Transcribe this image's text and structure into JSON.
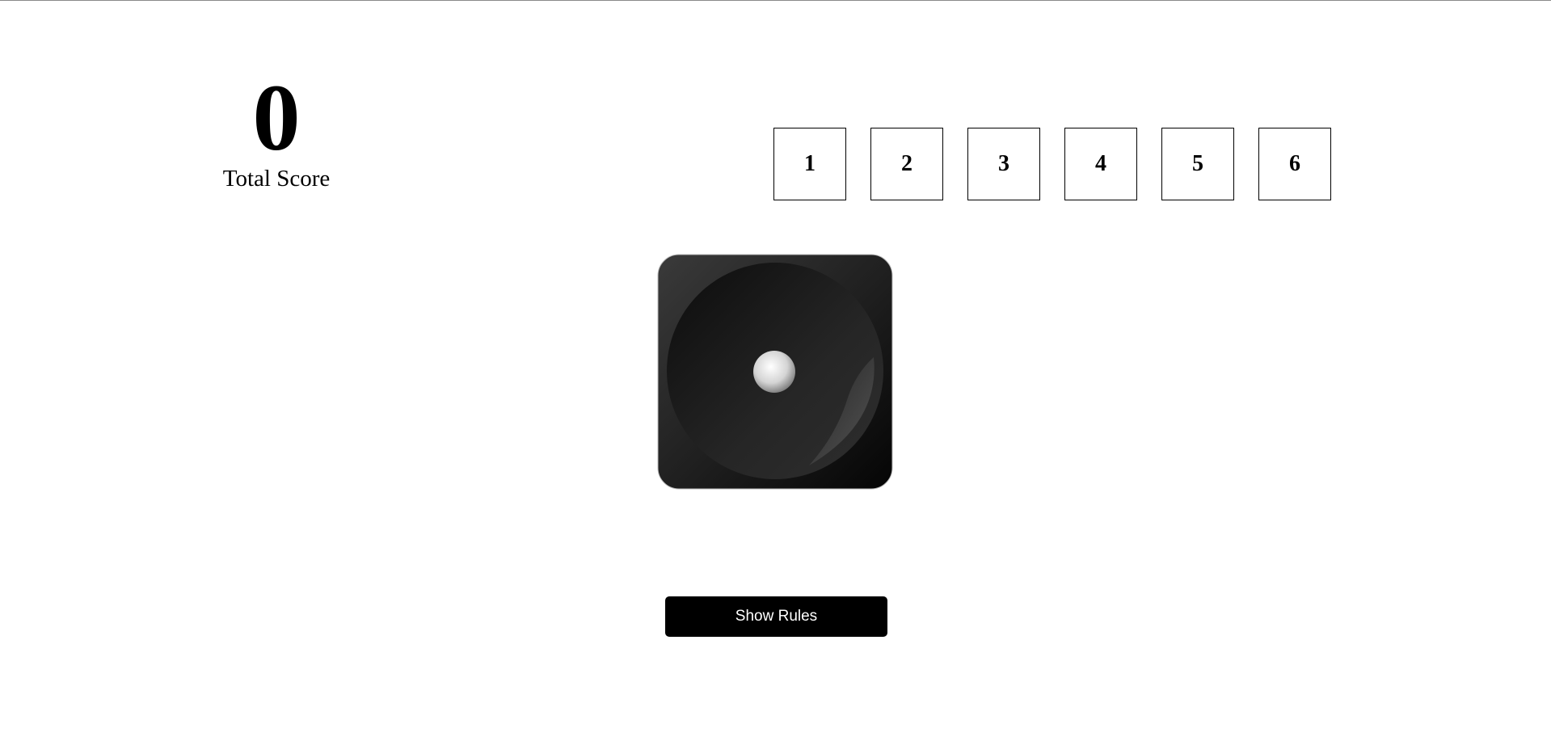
{
  "score": {
    "value": "0",
    "label": "Total Score"
  },
  "choices": [
    {
      "label": "1"
    },
    {
      "label": "2"
    },
    {
      "label": "3"
    },
    {
      "label": "4"
    },
    {
      "label": "5"
    },
    {
      "label": "6"
    }
  ],
  "die": {
    "face": 1,
    "color": "#1c1c1c",
    "pip_color": "#e6e6e6"
  },
  "controls": {
    "rules_label": "Show Rules"
  },
  "colors": {
    "background": "#ffffff",
    "button_bg": "#000000",
    "button_text": "#ffffff"
  }
}
